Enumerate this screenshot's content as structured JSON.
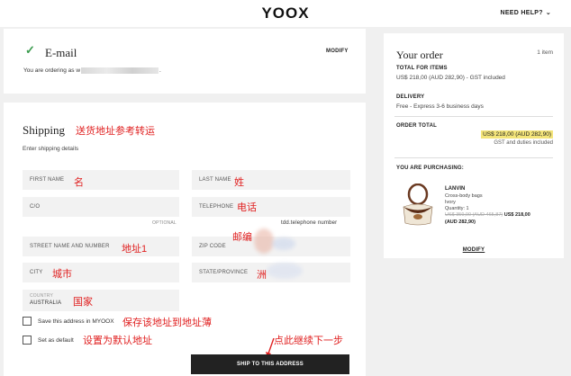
{
  "header": {
    "logo": "YOOX",
    "need_help": "NEED HELP?"
  },
  "email_section": {
    "title": "E-mail",
    "modify": "MODIFY",
    "ordering_prefix": "You are ordering as",
    "ordering_visible": "w",
    "ordering_suffix": "."
  },
  "shipping": {
    "title": "Shipping",
    "annotation_title": "送货地址参考转运",
    "subtitle": "Enter shipping details",
    "fields": {
      "first_name": {
        "label": "FIRST NAME",
        "annotation": "名"
      },
      "last_name": {
        "label": "LAST NAME",
        "annotation": "姓"
      },
      "co": {
        "label": "C/O",
        "optional": "OPTIONAL"
      },
      "telephone": {
        "label": "TELEPHONE",
        "annotation": "电话",
        "hint": "tdd.telephone number"
      },
      "street": {
        "label": "STREET NAME AND NUMBER",
        "annotation": "地址1"
      },
      "zip": {
        "label": "ZIP CODE",
        "annotation": "邮编"
      },
      "city": {
        "label": "CITY",
        "annotation": "城市"
      },
      "state": {
        "label": "STATE/PROVINCE",
        "annotation": "洲"
      },
      "country": {
        "label": "COUNTRY",
        "value": "AUSTRALIA",
        "annotation": "国家"
      }
    },
    "save_address": {
      "label": "Save this address in MYOOX",
      "annotation": "保存该地址到地址薄"
    },
    "set_default": {
      "label": "Set as default",
      "annotation": "设置为默认地址"
    },
    "button_annotation": "点此继续下一步",
    "ship_button": "SHIP TO THIS ADDRESS"
  },
  "order": {
    "title": "Your order",
    "item_count": "1 item",
    "total_items_label": "TOTAL FOR ITEMS",
    "total_items_value": "US$ 218,00 (AUD 282,90) - GST included",
    "delivery_label": "DELIVERY",
    "delivery_value": "Free - Express 3-6 business days",
    "order_total_label": "ORDER TOTAL",
    "order_total_value": "US$ 218,00 (AUD 282,90)",
    "gst_note": "GST and duties included",
    "purchasing_label": "YOU ARE PURCHASING:",
    "product": {
      "brand": "LANVIN",
      "type": "Cross-body bags",
      "color": "Ivory",
      "quantity": "Quantity: 1",
      "old_price": "US$ 359,00 (AUD 465,87)",
      "new_price": "US$ 218,00",
      "new_price_aud": "(AUD 282,90)"
    },
    "modify": "MODIFY"
  },
  "colors": {
    "annotation": "#e02020",
    "check": "#3b9b4e",
    "button": "#222222",
    "highlight": "#f4e57a"
  }
}
